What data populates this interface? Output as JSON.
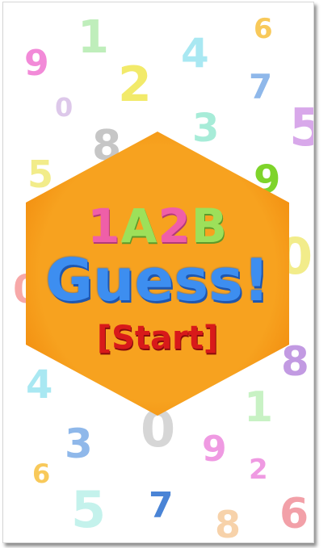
{
  "title": {
    "line1": [
      "1",
      "A",
      "2",
      "B"
    ],
    "line2": "Guess!",
    "start_label": "[Start]"
  },
  "colors": {
    "hexagon": "#f7a21f",
    "hexagon_glow": "#f28c0e",
    "title_pink": "#ef5fa8",
    "title_green": "#9de05a",
    "title_blue": "#3d8ef0",
    "start_red": "#d81a1a"
  },
  "background_digits": [
    {
      "d": "1",
      "color": "#bfeebb"
    },
    {
      "d": "6",
      "color": "#f8c95a"
    },
    {
      "d": "9",
      "color": "#f28ad8"
    },
    {
      "d": "2",
      "color": "#f2ea6a"
    },
    {
      "d": "4",
      "color": "#a9e8f2"
    },
    {
      "d": "7",
      "color": "#8fb8ea"
    },
    {
      "d": "0",
      "color": "#ddc8ea"
    },
    {
      "d": "8",
      "color": "#c6c6c6"
    },
    {
      "d": "3",
      "color": "#a7ecd8"
    },
    {
      "d": "5",
      "color": "#d8a8ea"
    },
    {
      "d": "5",
      "color": "#f2ec8a"
    },
    {
      "d": "9",
      "color": "#7ed42a"
    },
    {
      "d": "0",
      "color": "#f2ec8a"
    },
    {
      "d": "0",
      "color": "#f7a8a8"
    },
    {
      "d": "8",
      "color": "#c29ae2"
    },
    {
      "d": "4",
      "color": "#a9e8f2"
    },
    {
      "d": "1",
      "color": "#c8f2c4"
    },
    {
      "d": "0",
      "color": "#d6d6d6"
    },
    {
      "d": "3",
      "color": "#8fb8ea"
    },
    {
      "d": "9",
      "color": "#ef9ae2"
    },
    {
      "d": "2",
      "color": "#ef9ae2"
    },
    {
      "d": "6",
      "color": "#f8c95a"
    },
    {
      "d": "5",
      "color": "#c4f2ec"
    },
    {
      "d": "7",
      "color": "#4a84d6"
    },
    {
      "d": "8",
      "color": "#f7d2aa"
    },
    {
      "d": "6",
      "color": "#f2a0a8"
    }
  ]
}
